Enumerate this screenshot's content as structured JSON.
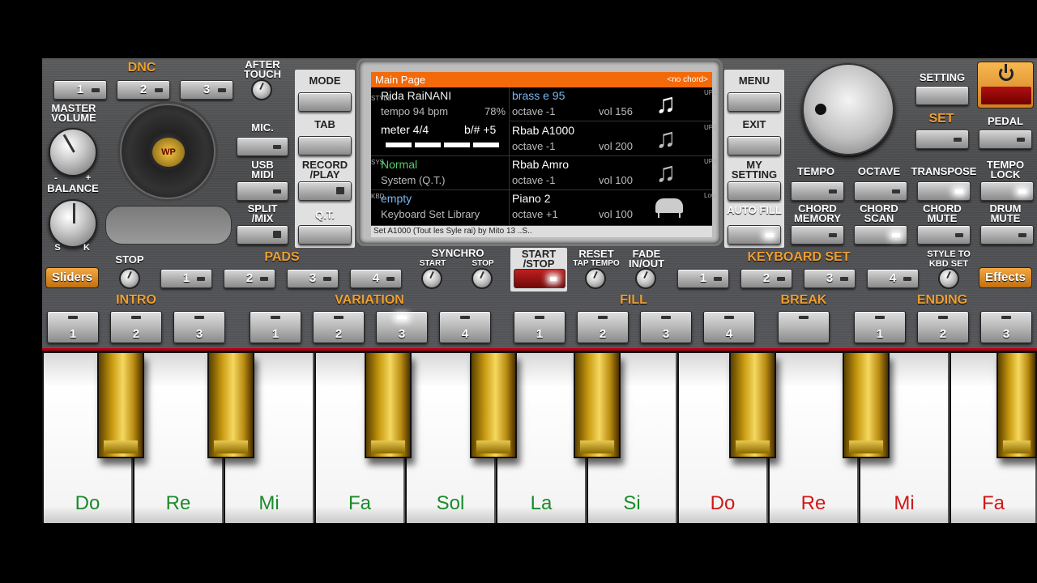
{
  "top": {
    "dnc_label": "DNC",
    "dnc_buttons": [
      "1",
      "2",
      "3"
    ],
    "after_touch": "AFTER TOUCH",
    "master_volume": "MASTER VOLUME",
    "balance": "BALANCE",
    "balance_left": "S",
    "balance_right": "K",
    "vol_min": "-",
    "vol_max": "+",
    "mic": "MIC.",
    "usb_midi": "USB MIDI",
    "split_mix": "SPLIT /MIX",
    "logo_text": "WP",
    "mode": "MODE",
    "tab": "TAB",
    "record_play": "RECORD /PLAY",
    "qt": "Q.T."
  },
  "screen": {
    "title": "Main Page",
    "no_chord": "<no chord>",
    "style_name": "Rida RaiNANI",
    "tempo": "tempo 94 bpm",
    "tempo_pct": "78%",
    "meter": "meter 4/4",
    "transpose": "b/# +5",
    "sys_name": "Normal",
    "sys_sub": "System (Q.T.)",
    "kbd_name": "empty",
    "kbd_sub": "Keyboard Set Library",
    "side_style": "STYLE",
    "side_sys": "SYS",
    "side_kbd": "KBD",
    "voices": [
      {
        "name": "brass e 95",
        "octave": "octave -1",
        "vol": "vol 156",
        "side": "UP1"
      },
      {
        "name": "Rbab A1000",
        "octave": "octave -1",
        "vol": "vol 200",
        "side": "UP2"
      },
      {
        "name": "Rbab Amro",
        "octave": "octave -1",
        "vol": "vol 100",
        "side": "UP3"
      },
      {
        "name": "Piano 2",
        "octave": "octave +1",
        "vol": "vol 100",
        "side": "Low"
      }
    ],
    "footer": "Set A1000 (Tout les Syle rai) by Mito 13 ..S.."
  },
  "right": {
    "menu": "MENU",
    "exit": "EXIT",
    "my_setting": "MY SETTING",
    "auto_fill": "AUTO FILL",
    "setting": "SETTING",
    "set": "SET",
    "pedal": "PEDAL",
    "tempo": "TEMPO",
    "octave": "OCTAVE",
    "transpose": "TRANSPOSE",
    "tempo_lock": "TEMPO LOCK",
    "chord_memory": "CHORD MEMORY",
    "chord_scan": "CHORD SCAN",
    "chord_mute": "CHORD MUTE",
    "drum_mute": "DRUM MUTE"
  },
  "mid": {
    "sliders": "Sliders",
    "effects": "Effects",
    "stop": "STOP",
    "pads": "PADS",
    "pad_buttons": [
      "1",
      "2",
      "3",
      "4"
    ],
    "synchro": "SYNCHRO",
    "sync_start": "START",
    "sync_stop": "STOP",
    "start_stop": "START /STOP",
    "reset": "RESET",
    "tap_tempo": "TAP TEMPO",
    "fade": "FADE IN/OUT",
    "keyboard_set": "KEYBOARD SET",
    "kbd_buttons": [
      "1",
      "2",
      "3",
      "4"
    ],
    "style_to_kbd": "STYLE TO KBD SET"
  },
  "sections": {
    "intro": "INTRO",
    "intro_buttons": [
      "1",
      "2",
      "3"
    ],
    "variation": "VARIATION",
    "variation_buttons": [
      "1",
      "2",
      "3",
      "4"
    ],
    "fill": "FILL",
    "fill_buttons": [
      "1",
      "2",
      "3",
      "4"
    ],
    "break": "BREAK",
    "ending": "ENDING",
    "ending_buttons": [
      "1",
      "2",
      "3"
    ]
  },
  "keys": [
    "Do",
    "Re",
    "Mi",
    "Fa",
    "Sol",
    "La",
    "Si",
    "Do",
    "Re",
    "Mi",
    "Fa"
  ],
  "colors": {
    "note_green": "#1a8a2a",
    "note_red": "#d01818",
    "accent_orange": "#f26a0a"
  }
}
